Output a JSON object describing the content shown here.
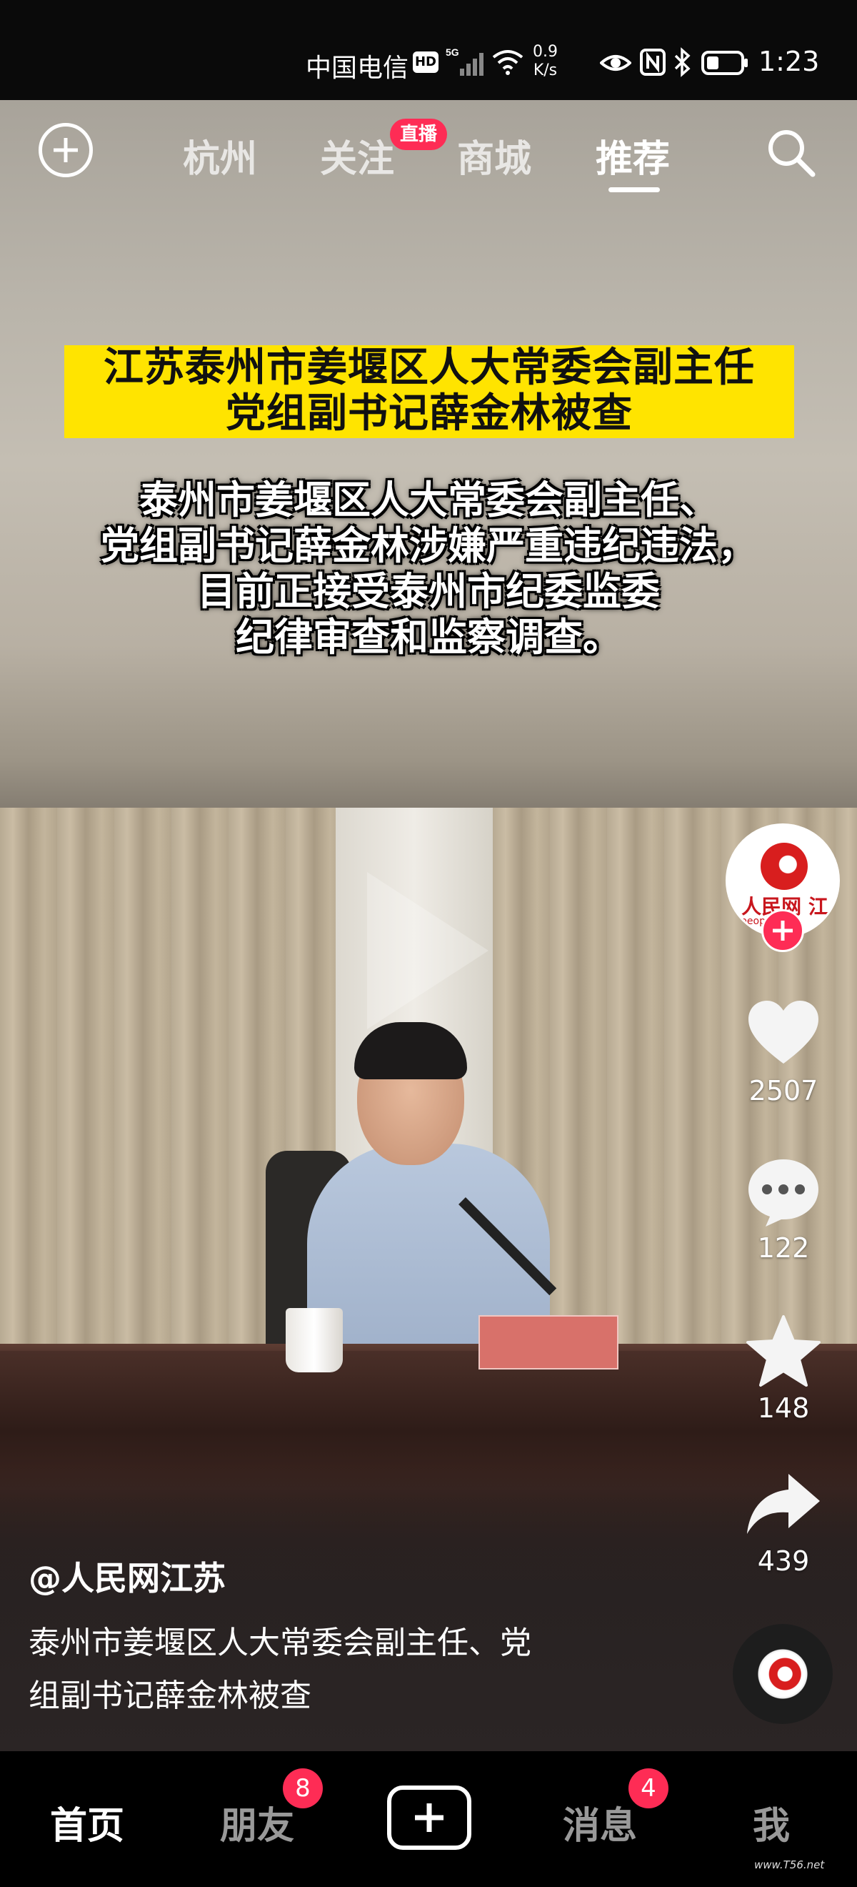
{
  "status_bar": {
    "carrier": "中国电信",
    "hd_badge": "HD",
    "network_type": "5G",
    "speed_value": "0.9",
    "speed_unit": "K/s",
    "time": "1:23"
  },
  "top_nav": {
    "tabs": [
      {
        "label": "杭州"
      },
      {
        "label": "关注",
        "badge": "直播"
      },
      {
        "label": "商城"
      },
      {
        "label": "推荐"
      }
    ],
    "active_tab": "推荐"
  },
  "video": {
    "headline_lines": [
      "江苏泰州市姜堰区人大常委会副主任",
      "党组副书记薛金林被查"
    ],
    "subtitle_lines": [
      "泰州市姜堰区人大常委会副主任、",
      "党组副书记薛金林涉嫌严重违纪违法，",
      "目前正接受泰州市纪委监委",
      "纪律审查和监察调查。"
    ]
  },
  "right_rail": {
    "avatar_text": "人民网 江苏",
    "avatar_subtext": "people.cn",
    "likes": "2507",
    "comments": "122",
    "favorites": "148",
    "shares": "439"
  },
  "caption": {
    "author": "@人民网江苏",
    "text_lines": [
      "泰州市姜堰区人大常委会副主任、党",
      "组副书记薛金林被查"
    ]
  },
  "bottom_nav": {
    "home": "首页",
    "friends": "朋友",
    "friends_badge": "8",
    "messages": "消息",
    "messages_badge": "4",
    "me": "我"
  },
  "watermark": "www.T56.net",
  "colors": {
    "accent": "#fe2c55",
    "headline_bg": "#ffe400"
  }
}
